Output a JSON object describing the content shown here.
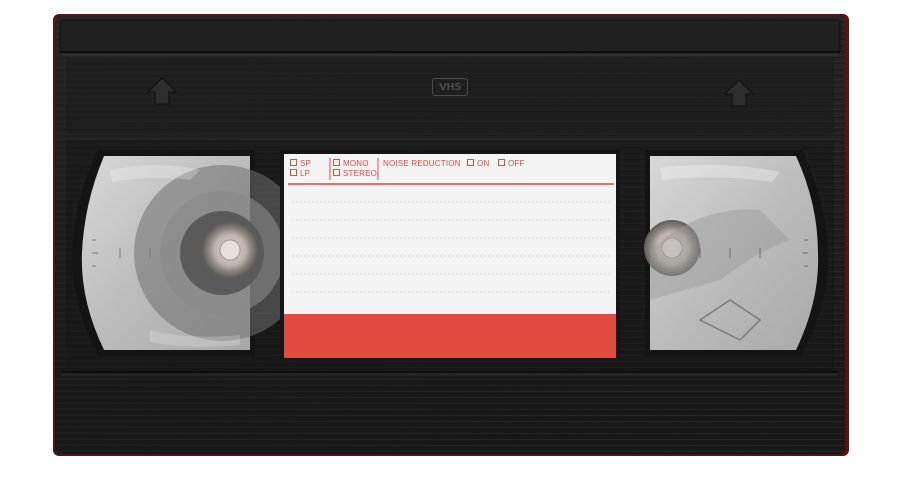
{
  "cassette": {
    "logo_text": "VHS",
    "colors": {
      "shell": "#1f1f1f",
      "shell_dark": "#141414",
      "edge_red": "#6a1515",
      "label_paper": "#f4f4f4",
      "label_accent": "#e04a3f",
      "window": "#cfcfcf"
    }
  },
  "label": {
    "sp": "SP",
    "lp": "LP",
    "mono": "MONO",
    "stereo": "STEREO",
    "noise_reduction": "NOISE REDUCTION",
    "on": "ON",
    "off": "OFF"
  }
}
